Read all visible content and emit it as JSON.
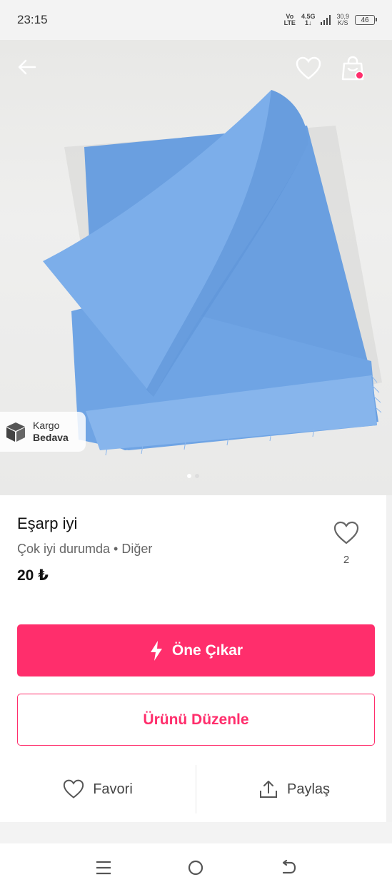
{
  "status_bar": {
    "time": "23:15",
    "carrier_top": "Vo",
    "carrier_bottom": "LTE",
    "network_top": "4.5G",
    "network_bottom": "1↓",
    "speed_top": "30,9",
    "speed_bottom": "K/S",
    "battery": "46"
  },
  "gallery": {
    "badge_line1": "Kargo",
    "badge_line2": "Bedava",
    "image_count": 2,
    "active_index": 0
  },
  "product": {
    "title": "Eşarp iyi",
    "subtitle": "Çok iyi durumda • Diğer",
    "price": "20 ₺",
    "like_count": "2"
  },
  "buttons": {
    "promote": "Öne Çıkar",
    "edit": "Ürünü Düzenle",
    "favorite": "Favori",
    "share": "Paylaş"
  },
  "colors": {
    "accent": "#ff2e6c",
    "scarf": "#6fa4e4"
  },
  "icons": [
    "back-arrow-icon",
    "heart-icon",
    "shopping-bag-icon",
    "box-icon",
    "lightning-icon",
    "share-icon",
    "menu-icon",
    "home-circle-icon",
    "back-nav-icon"
  ]
}
